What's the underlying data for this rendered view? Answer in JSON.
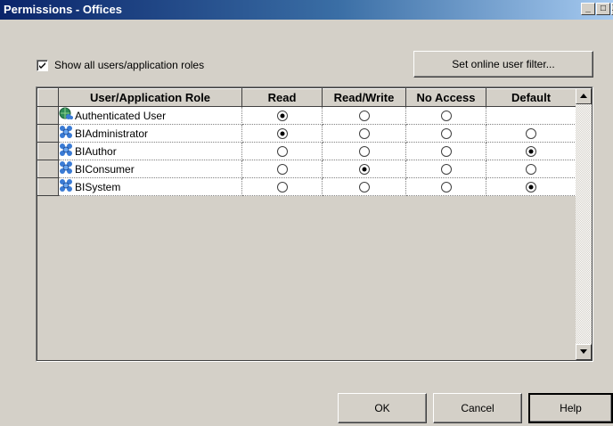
{
  "window": {
    "title": "Permissions - Offices",
    "controls": {
      "minimize": "_",
      "maximize": "□",
      "close": "X"
    }
  },
  "show_all": {
    "label": "Show all users/application roles",
    "checked": true
  },
  "filter_button": "Set online user filter...",
  "grid": {
    "columns": [
      "User/Application Role",
      "Read",
      "Read/Write",
      "No Access",
      "Default"
    ],
    "rows": [
      {
        "name": "Authenticated User",
        "icon": "globe-users-icon",
        "read": true,
        "read_write": false,
        "no_access": false,
        "default": null
      },
      {
        "name": "BIAdministrator",
        "icon": "group-icon",
        "read": true,
        "read_write": false,
        "no_access": false,
        "default": false
      },
      {
        "name": "BIAuthor",
        "icon": "group-icon",
        "read": false,
        "read_write": false,
        "no_access": false,
        "default": true
      },
      {
        "name": "BIConsumer",
        "icon": "group-icon",
        "read": false,
        "read_write": true,
        "no_access": false,
        "default": false
      },
      {
        "name": "BISystem",
        "icon": "group-icon",
        "read": false,
        "read_write": false,
        "no_access": false,
        "default": true
      }
    ]
  },
  "buttons": {
    "ok": "OK",
    "cancel": "Cancel",
    "help": "Help"
  },
  "colors": {
    "dialog_bg": "#d4d0c8",
    "title_start": "#0a246a",
    "title_end": "#a6caf0"
  }
}
